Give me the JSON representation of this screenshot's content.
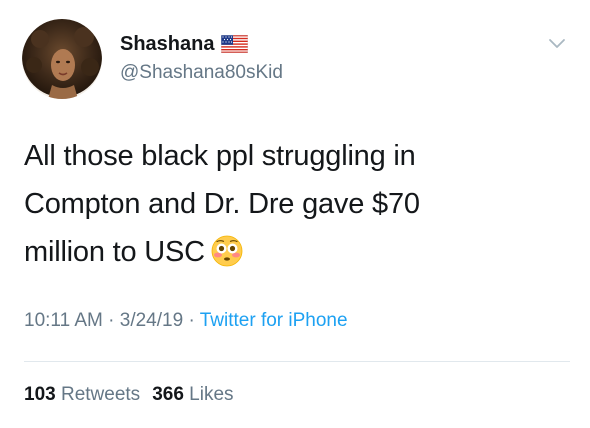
{
  "tweet": {
    "display_name": "Shashana",
    "flag_icon": "us-flag-icon",
    "handle": "@Shashana80sKid",
    "text": {
      "line1": "All those black ppl struggling in",
      "line2": "Compton and Dr. Dre gave $70",
      "line3": "million to USC"
    },
    "emoji_icon": "flushed-face-icon",
    "time": "10:11 AM",
    "sep1": " · ",
    "date": "3/24/19",
    "sep2": " · ",
    "source": "Twitter for iPhone",
    "retweets": {
      "count": "103",
      "label": "Retweets"
    },
    "likes": {
      "count": "366",
      "label": "Likes"
    },
    "colors": {
      "text": "#14171a",
      "secondary": "#657786",
      "link": "#1da1f2",
      "divider": "#e1e8ed"
    }
  }
}
